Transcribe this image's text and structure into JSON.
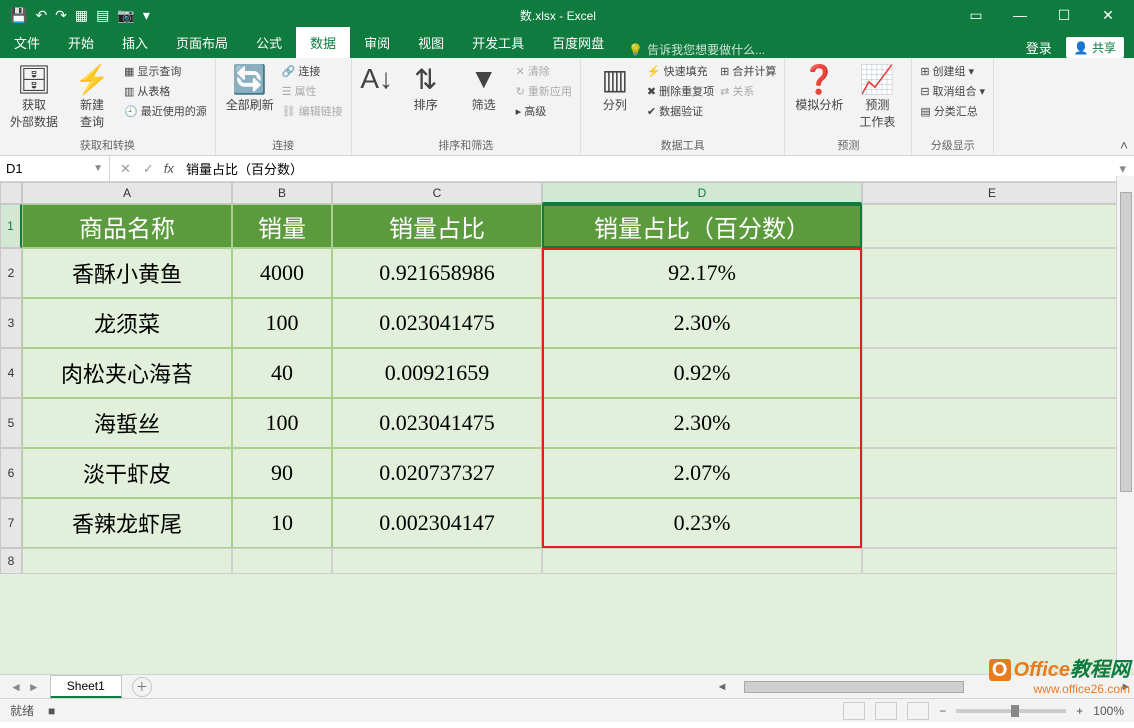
{
  "title": "数.xlsx - Excel",
  "qat": {
    "save": "💾",
    "undo": "↶",
    "redo": "↷"
  },
  "win": {
    "login": "登录",
    "share": "共享"
  },
  "tabs": [
    "文件",
    "开始",
    "插入",
    "页面布局",
    "公式",
    "数据",
    "审阅",
    "视图",
    "开发工具",
    "百度网盘"
  ],
  "active_tab": 5,
  "tell_me": "告诉我您想要做什么...",
  "ribbon": {
    "g1": {
      "btn1": "获取\n外部数据",
      "btn2": "新建\n查询",
      "s1": "显示查询",
      "s2": "从表格",
      "s3": "最近使用的源",
      "label": "获取和转换"
    },
    "g2": {
      "btn": "全部刷新",
      "s1": "连接",
      "s2": "属性",
      "s3": "编辑链接",
      "label": "连接"
    },
    "g3": {
      "btn1": "排序",
      "btn2": "筛选",
      "s1": "清除",
      "s2": "重新应用",
      "s3": "高级",
      "label": "排序和筛选"
    },
    "g4": {
      "btn": "分列",
      "s1": "快速填充",
      "s2": "删除重复项",
      "s3": "数据验证",
      "s4": "合并计算",
      "s5": "关系",
      "label": "数据工具"
    },
    "g5": {
      "btn1": "模拟分析",
      "btn2": "预测\n工作表",
      "label": "预测"
    },
    "g6": {
      "s1": "创建组",
      "s2": "取消组合",
      "s3": "分类汇总",
      "label": "分级显示"
    }
  },
  "namebox": "D1",
  "formula": "销量占比（百分数）",
  "cols": [
    "A",
    "B",
    "C",
    "D",
    "E"
  ],
  "rows": [
    "1",
    "2",
    "3",
    "4",
    "5",
    "6",
    "7",
    "8"
  ],
  "headers": {
    "a": "商品名称",
    "b": "销量",
    "c": "销量占比",
    "d": "销量占比（百分数）"
  },
  "data": [
    {
      "a": "香酥小黄鱼",
      "b": "4000",
      "c": "0.921658986",
      "d": "92.17%"
    },
    {
      "a": "龙须菜",
      "b": "100",
      "c": "0.023041475",
      "d": "2.30%"
    },
    {
      "a": "肉松夹心海苔",
      "b": "40",
      "c": "0.00921659",
      "d": "0.92%"
    },
    {
      "a": "海蜇丝",
      "b": "100",
      "c": "0.023041475",
      "d": "2.30%"
    },
    {
      "a": "淡干虾皮",
      "b": "90",
      "c": "0.020737327",
      "d": "2.07%"
    },
    {
      "a": "香辣龙虾尾",
      "b": "10",
      "c": "0.002304147",
      "d": "0.23%"
    }
  ],
  "sheet": "Sheet1",
  "status": {
    "ready": "就绪",
    "rec": "■",
    "zoom": "100%"
  },
  "watermark": {
    "brand1": "Office",
    "brand2": "教程网",
    "url": "www.office26.com"
  },
  "chart_data": {
    "type": "table",
    "columns": [
      "商品名称",
      "销量",
      "销量占比",
      "销量占比（百分数）"
    ],
    "rows": [
      [
        "香酥小黄鱼",
        4000,
        0.921658986,
        "92.17%"
      ],
      [
        "龙须菜",
        100,
        0.023041475,
        "2.30%"
      ],
      [
        "肉松夹心海苔",
        40,
        0.00921659,
        "0.92%"
      ],
      [
        "海蜇丝",
        100,
        0.023041475,
        "2.30%"
      ],
      [
        "淡干虾皮",
        90,
        0.020737327,
        "2.07%"
      ],
      [
        "香辣龙虾尾",
        10,
        0.002304147,
        "0.23%"
      ]
    ]
  }
}
